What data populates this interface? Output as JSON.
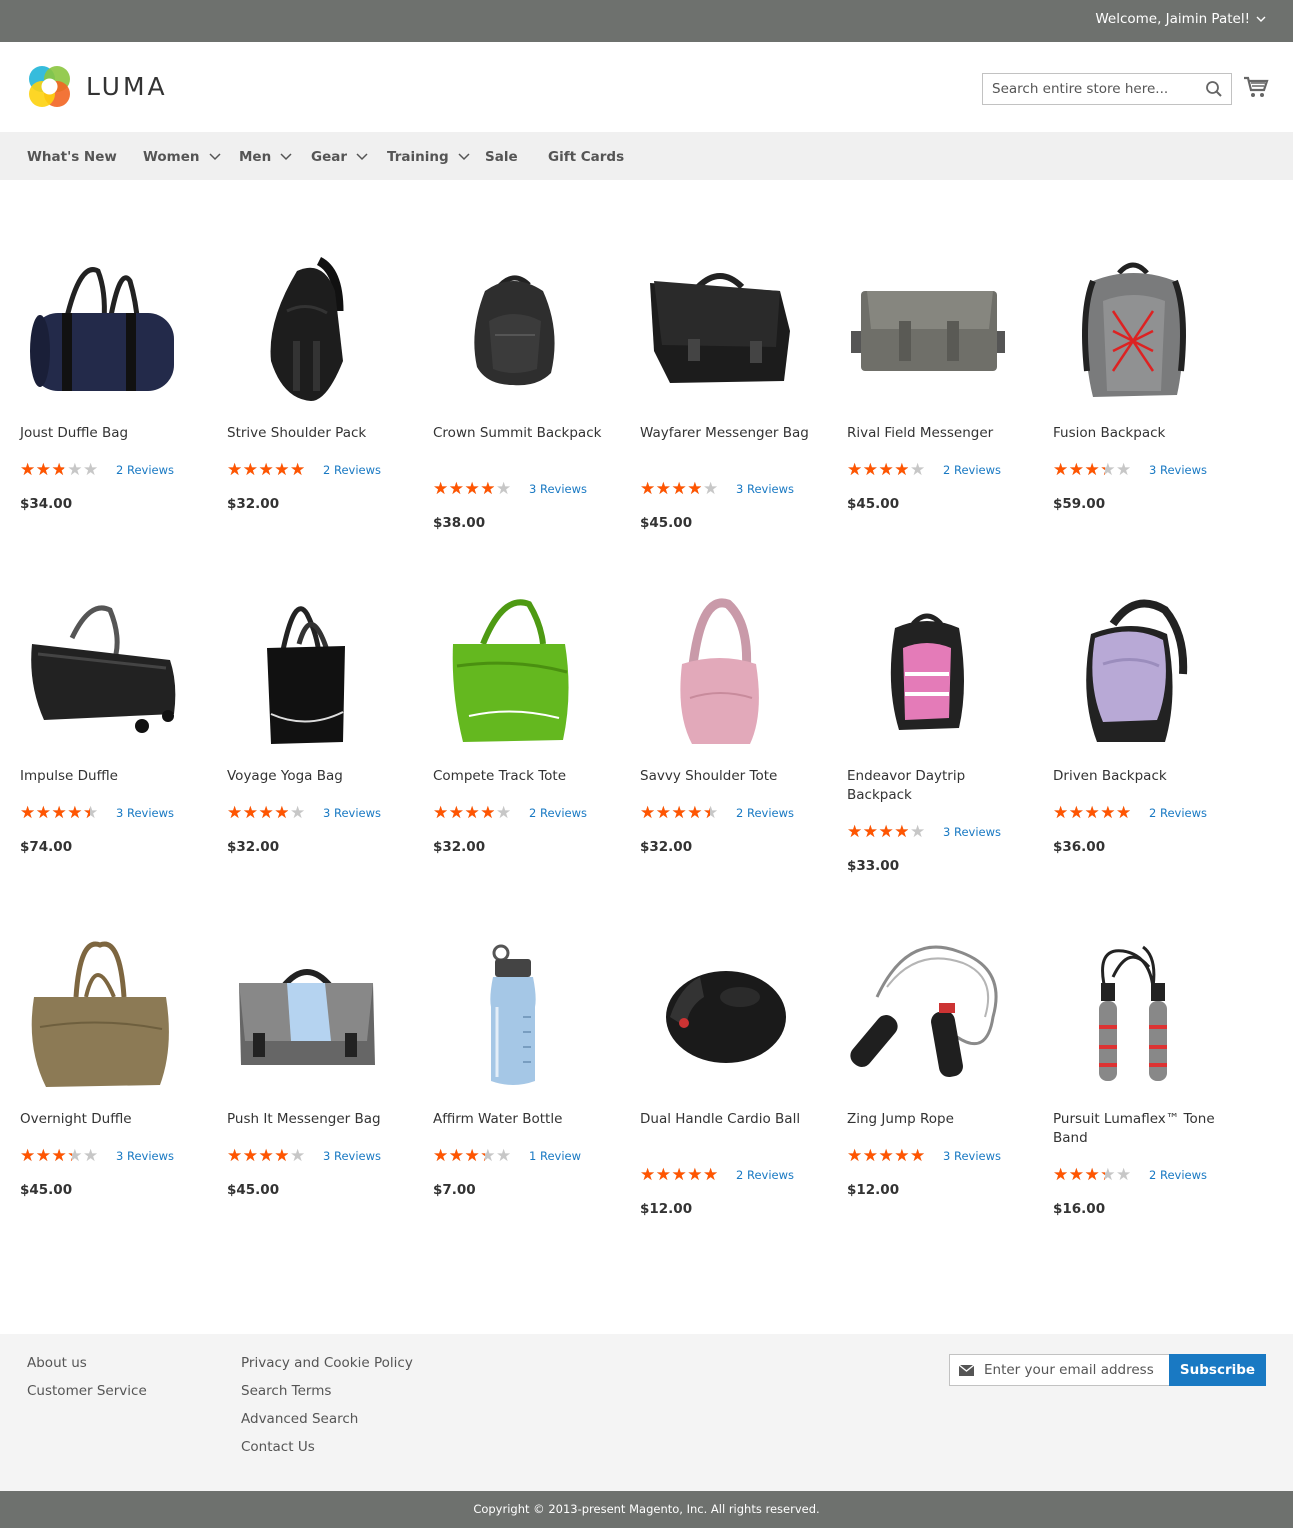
{
  "topbar": {
    "welcome": "Welcome, Jaimin Patel!"
  },
  "header": {
    "logo_text": "LUMA",
    "search_placeholder": "Search entire store here...",
    "icons": {
      "search": "search-icon",
      "cart": "cart-icon"
    }
  },
  "nav": [
    {
      "label": "What's New",
      "dropdown": false
    },
    {
      "label": "Women",
      "dropdown": true
    },
    {
      "label": "Men",
      "dropdown": true
    },
    {
      "label": "Gear",
      "dropdown": true
    },
    {
      "label": "Training",
      "dropdown": true
    },
    {
      "label": "Sale",
      "dropdown": false
    },
    {
      "label": "Gift Cards",
      "dropdown": false
    }
  ],
  "products": [
    {
      "name": "Joust Duffle Bag",
      "rating": 2.5,
      "reviews": "2 Reviews",
      "price": "$34.00",
      "image": "navy-duffle-bag"
    },
    {
      "name": "Strive Shoulder Pack",
      "rating": 4.5,
      "reviews": "2 Reviews",
      "price": "$32.00",
      "image": "black-sling-pack"
    },
    {
      "name": "Crown Summit Backpack",
      "rating": 3.5,
      "reviews": "3 Reviews",
      "price": "$38.00",
      "image": "black-backpack"
    },
    {
      "name": "Wayfarer Messenger Bag",
      "rating": 3.5,
      "reviews": "3 Reviews",
      "price": "$45.00",
      "image": "black-messenger-bag"
    },
    {
      "name": "Rival Field Messenger",
      "rating": 3.5,
      "reviews": "2 Reviews",
      "price": "$45.00",
      "image": "gray-messenger-bag"
    },
    {
      "name": "Fusion Backpack",
      "rating": 3.0,
      "reviews": "3 Reviews",
      "price": "$59.00",
      "image": "gray-red-backpack"
    },
    {
      "name": "Impulse Duffle",
      "rating": 4.0,
      "reviews": "3 Reviews",
      "price": "$74.00",
      "image": "black-rolling-duffle"
    },
    {
      "name": "Voyage Yoga Bag",
      "rating": 3.5,
      "reviews": "3 Reviews",
      "price": "$32.00",
      "image": "black-yoga-tote"
    },
    {
      "name": "Compete Track Tote",
      "rating": 3.5,
      "reviews": "2 Reviews",
      "price": "$32.00",
      "image": "green-tote"
    },
    {
      "name": "Savvy Shoulder Tote",
      "rating": 4.0,
      "reviews": "2 Reviews",
      "price": "$32.00",
      "image": "pink-shoulder-tote"
    },
    {
      "name": "Endeavor Daytrip Backpack",
      "rating": 3.5,
      "reviews": "3 Reviews",
      "price": "$33.00",
      "image": "pink-backpack"
    },
    {
      "name": "Driven Backpack",
      "rating": 4.5,
      "reviews": "2 Reviews",
      "price": "$36.00",
      "image": "lavender-backpack"
    },
    {
      "name": "Overnight Duffle",
      "rating": 3.0,
      "reviews": "3 Reviews",
      "price": "$45.00",
      "image": "tan-duffle"
    },
    {
      "name": "Push It Messenger Bag",
      "rating": 3.5,
      "reviews": "3 Reviews",
      "price": "$45.00",
      "image": "blue-gray-messenger-bag"
    },
    {
      "name": "Affirm Water Bottle",
      "rating": 3.0,
      "reviews": "1 Review",
      "price": "$7.00",
      "image": "water-bottle"
    },
    {
      "name": "Dual Handle Cardio Ball",
      "rating": 5.0,
      "reviews": "2 Reviews",
      "price": "$12.00",
      "image": "cardio-ball"
    },
    {
      "name": "Zing Jump Rope",
      "rating": 4.5,
      "reviews": "3 Reviews",
      "price": "$12.00",
      "image": "jump-rope"
    },
    {
      "name": "Pursuit Lumaflex™ Tone Band",
      "rating": 3.0,
      "reviews": "2 Reviews",
      "price": "$16.00",
      "image": "tone-band"
    }
  ],
  "footer": {
    "col1": [
      "About us",
      "Customer Service"
    ],
    "col2": [
      "Privacy and Cookie Policy",
      "Search Terms",
      "Advanced Search",
      "Contact Us"
    ],
    "newsletter_placeholder": "Enter your email address",
    "subscribe_label": "Subscribe",
    "copyright": "Copyright © 2013-present Magento, Inc. All rights reserved."
  },
  "colors": {
    "topbar": "#6e716e",
    "nav_bg": "#f0f0f0",
    "star": "#ff5501",
    "link": "#1979c3",
    "button": "#1979c3",
    "footer_bg": "#f4f4f4"
  }
}
